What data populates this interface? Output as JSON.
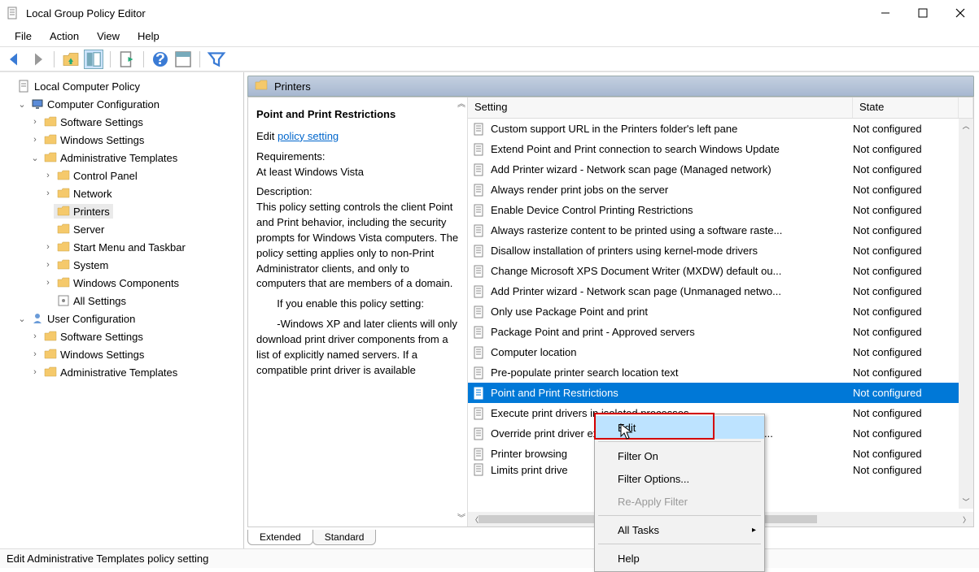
{
  "window": {
    "title": "Local Group Policy Editor"
  },
  "menubar": {
    "items": [
      "File",
      "Action",
      "View",
      "Help"
    ]
  },
  "tree": {
    "nodes": [
      {
        "label": "Local Computer Policy",
        "level": 1,
        "icon": "doc",
        "expander": "none"
      },
      {
        "label": "Computer Configuration",
        "level": 2,
        "icon": "pc",
        "expander": "open"
      },
      {
        "label": "Software Settings",
        "level": 3,
        "icon": "folder",
        "expander": "closed"
      },
      {
        "label": "Windows Settings",
        "level": 3,
        "icon": "folder",
        "expander": "closed"
      },
      {
        "label": "Administrative Templates",
        "level": 3,
        "icon": "folder",
        "expander": "open"
      },
      {
        "label": "Control Panel",
        "level": 4,
        "icon": "folder",
        "expander": "closed"
      },
      {
        "label": "Network",
        "level": 4,
        "icon": "folder",
        "expander": "closed"
      },
      {
        "label": "Printers",
        "level": 4,
        "icon": "folder",
        "expander": "none",
        "selected": true
      },
      {
        "label": "Server",
        "level": 4,
        "icon": "folder",
        "expander": "none"
      },
      {
        "label": "Start Menu and Taskbar",
        "level": 4,
        "icon": "folder",
        "expander": "closed"
      },
      {
        "label": "System",
        "level": 4,
        "icon": "folder",
        "expander": "closed"
      },
      {
        "label": "Windows Components",
        "level": 4,
        "icon": "folder",
        "expander": "closed"
      },
      {
        "label": "All Settings",
        "level": 4,
        "icon": "settings",
        "expander": "none"
      },
      {
        "label": "User Configuration",
        "level": 2,
        "icon": "user",
        "expander": "open"
      },
      {
        "label": "Software Settings",
        "level": 3,
        "icon": "folder",
        "expander": "closed"
      },
      {
        "label": "Windows Settings",
        "level": 3,
        "icon": "folder",
        "expander": "closed"
      },
      {
        "label": "Administrative Templates",
        "level": 3,
        "icon": "folder",
        "expander": "closed"
      }
    ]
  },
  "category": {
    "title": "Printers"
  },
  "details": {
    "title": "Point and Print Restrictions",
    "edit_prefix": "Edit ",
    "edit_link": "policy setting",
    "req_label": "Requirements:",
    "req_text": "At least Windows Vista",
    "desc_label": "Description:",
    "desc_text": "This policy setting controls the client Point and Print behavior, including the security prompts for Windows Vista computers. The policy setting applies only to non-Print Administrator clients, and only to computers that are members of a domain.",
    "enable_text": "       If you enable this policy setting:",
    "xp_text": "       -Windows XP and later clients will only download print driver components from a list of explicitly named servers. If a compatible print driver is available"
  },
  "list": {
    "header": {
      "setting": "Setting",
      "state": "State"
    },
    "rows": [
      {
        "setting": "Custom support URL in the Printers folder's left pane",
        "state": "Not configured"
      },
      {
        "setting": "Extend Point and Print connection to search Windows Update",
        "state": "Not configured"
      },
      {
        "setting": "Add Printer wizard - Network scan page (Managed network)",
        "state": "Not configured"
      },
      {
        "setting": "Always render print jobs on the server",
        "state": "Not configured"
      },
      {
        "setting": "Enable Device Control Printing Restrictions",
        "state": "Not configured"
      },
      {
        "setting": "Always rasterize content to be printed using a software raste...",
        "state": "Not configured"
      },
      {
        "setting": "Disallow installation of printers using kernel-mode drivers",
        "state": "Not configured"
      },
      {
        "setting": "Change Microsoft XPS Document Writer (MXDW) default ou...",
        "state": "Not configured"
      },
      {
        "setting": "Add Printer wizard - Network scan page (Unmanaged netwo...",
        "state": "Not configured"
      },
      {
        "setting": "Only use Package Point and print",
        "state": "Not configured"
      },
      {
        "setting": "Package Point and print - Approved servers",
        "state": "Not configured"
      },
      {
        "setting": "Computer location",
        "state": "Not configured"
      },
      {
        "setting": "Pre-populate printer search location text",
        "state": "Not configured"
      },
      {
        "setting": "Point and Print Restrictions",
        "state": "Not configured",
        "selected": true
      },
      {
        "setting": "Execute print drivers in isolated processes",
        "state": "Not configured"
      },
      {
        "setting": "Override print driver execution compatibility setting reporte...",
        "state": "Not configured"
      },
      {
        "setting": "Printer browsing",
        "state": "Not configured"
      },
      {
        "setting": "Limits print drive",
        "state": "Not configured",
        "cut": true
      }
    ]
  },
  "context_menu": {
    "items": [
      {
        "label": "Edit",
        "hovered": true
      },
      {
        "sep": true
      },
      {
        "label": "Filter On"
      },
      {
        "label": "Filter Options..."
      },
      {
        "label": "Re-Apply Filter",
        "disabled": true
      },
      {
        "sep": true
      },
      {
        "label": "All Tasks",
        "sub": true
      },
      {
        "sep": true
      },
      {
        "label": "Help"
      }
    ]
  },
  "tabs": {
    "extended": "Extended",
    "standard": "Standard"
  },
  "statusbar": {
    "text": "Edit Administrative Templates policy setting"
  }
}
